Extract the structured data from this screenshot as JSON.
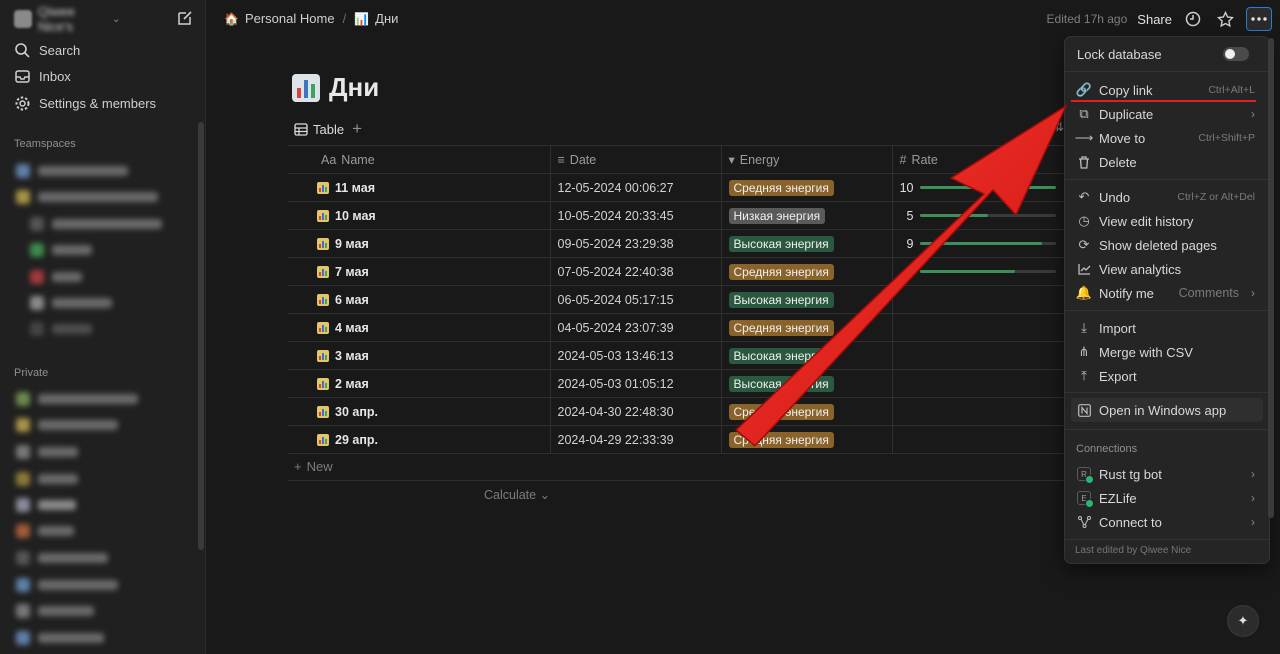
{
  "sidebar": {
    "workspace_name": "Qiwee Nice's",
    "items": [
      {
        "label": "Search",
        "icon": "search-icon"
      },
      {
        "label": "Inbox",
        "icon": "inbox-icon"
      },
      {
        "label": "Settings & members",
        "icon": "gear-icon"
      }
    ],
    "teamspaces_heading": "Teamspaces",
    "private_heading": "Private"
  },
  "topbar": {
    "breadcrumb_home": "Personal Home",
    "breadcrumb_sep": "/",
    "breadcrumb_page": "Дни",
    "edited": "Edited 17h ago",
    "share": "Share"
  },
  "page": {
    "title": "Дни",
    "view_tab": "Table",
    "columns": {
      "name": "Name",
      "date": "Date",
      "energy": "Energy",
      "rate": "Rate"
    },
    "name_prefix": "Aa",
    "rows": [
      {
        "name": "11 мая",
        "date": "12-05-2024 00:06:27",
        "energy": "Средняя энергия",
        "energy_color": "#89632a",
        "rate": "10",
        "rate_fraction": 1.0
      },
      {
        "name": "10 мая",
        "date": "10-05-2024 20:33:45",
        "energy": "Низкая энергия",
        "energy_color": "#5a5a5a",
        "rate": "5",
        "rate_fraction": 0.5
      },
      {
        "name": "9 мая",
        "date": "09-05-2024 23:29:38",
        "energy": "Высокая энергия",
        "energy_color": "#2b593f",
        "rate": "9",
        "rate_fraction": 0.9
      },
      {
        "name": "7 мая",
        "date": "07-05-2024 22:40:38",
        "energy": "Средняя энергия",
        "energy_color": "#89632a",
        "rate": "",
        "rate_fraction": 0.7
      },
      {
        "name": "6 мая",
        "date": "06-05-2024 05:17:15",
        "energy": "Высокая энергия",
        "energy_color": "#2b593f",
        "rate": ""
      },
      {
        "name": "4 мая",
        "date": "04-05-2024 23:07:39",
        "energy": "Средняя энергия",
        "energy_color": "#89632a",
        "rate": ""
      },
      {
        "name": "3 мая",
        "date": "2024-05-03 13:46:13",
        "energy": "Высокая энергия",
        "energy_color": "#2b593f",
        "rate": ""
      },
      {
        "name": "2 мая",
        "date": "2024-05-03 01:05:12",
        "energy": "Высокая энергия",
        "energy_color": "#2b593f",
        "rate": ""
      },
      {
        "name": "30 апр.",
        "date": "2024-04-30 22:48:30",
        "energy": "Средняя энергия",
        "energy_color": "#89632a",
        "rate": ""
      },
      {
        "name": "29 апр.",
        "date": "2024-04-29 22:33:39",
        "energy": "Средняя энергия",
        "energy_color": "#89632a",
        "rate": ""
      }
    ],
    "new_label": "New",
    "calculate_label": "Calculate"
  },
  "menu": {
    "lock_label": "Lock database",
    "copy_link": {
      "label": "Copy link",
      "shortcut": "Ctrl+Alt+L"
    },
    "duplicate": "Duplicate",
    "move_to": {
      "label": "Move to",
      "shortcut": "Ctrl+Shift+P"
    },
    "delete": "Delete",
    "undo": {
      "label": "Undo",
      "shortcut": "Ctrl+Z or Alt+Del"
    },
    "view_history": "View edit history",
    "show_deleted": "Show deleted pages",
    "view_analytics": "View analytics",
    "notify": {
      "label": "Notify me",
      "value": "Comments"
    },
    "import": "Import",
    "merge_csv": "Merge with CSV",
    "export": "Export",
    "open_windows": "Open in Windows app",
    "connections_heading": "Connections",
    "conn_1": {
      "label": "Rust tg bot",
      "badge": "R"
    },
    "conn_2": {
      "label": "EZLife",
      "badge": "E"
    },
    "connect_to": "Connect to",
    "footer": "Last edited by Qiwee Nice"
  },
  "colors": {
    "accent": "#2e7bd6",
    "annotation_arrow": "#e02020",
    "progress": "#3f8f5a"
  }
}
